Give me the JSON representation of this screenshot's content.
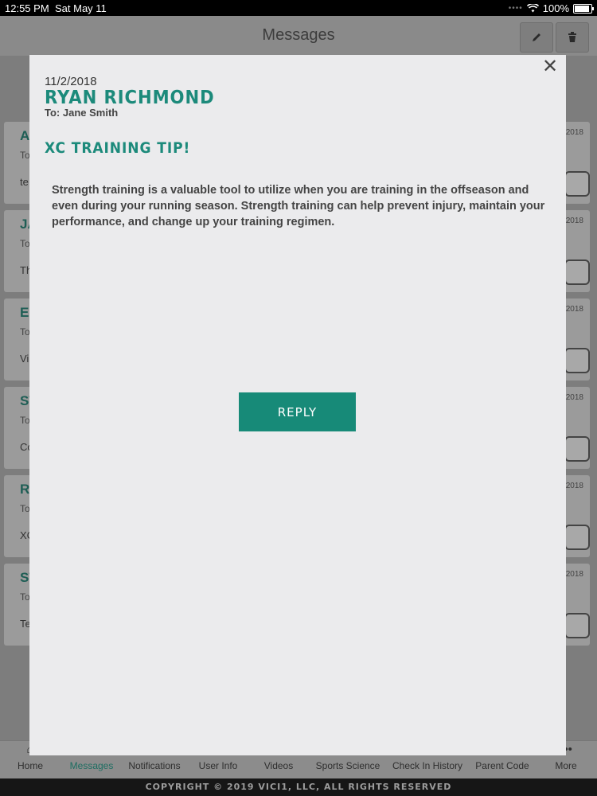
{
  "status_bar": {
    "time": "12:55 PM",
    "date": "Sat May 11",
    "battery": "100%",
    "battery_level": 1.0
  },
  "header": {
    "title": "Messages",
    "compose_icon": "pencil-icon",
    "delete_icon": "trash-icon"
  },
  "background_list": [
    {
      "initial": "A",
      "to": "To",
      "snippet": "te",
      "date": "/2018"
    },
    {
      "initial": "JA",
      "to": "To",
      "snippet": "Th",
      "date": "/2018"
    },
    {
      "initial": "EI",
      "to": "To",
      "snippet": "Vi",
      "date": "/2018"
    },
    {
      "initial": "ST",
      "to": "To",
      "snippet": "Co",
      "date": "/2018"
    },
    {
      "initial": "R",
      "to": "To",
      "snippet": "XC",
      "date": "/2018"
    },
    {
      "initial": "ST",
      "to": "To",
      "snippet": "Te",
      "date": "/2018"
    }
  ],
  "modal": {
    "close_icon": "close-icon",
    "date": "11/2/2018",
    "sender": "RYAN RICHMOND",
    "to": "To: Jane Smith",
    "subject": "XC TRAINING TIP!",
    "body": "Strength training is a valuable tool to utilize when you are training in the offseason and even during your running season. Strength training can help prevent injury, maintain your performance, and change up your training regimen.",
    "reply_label": "REPLY"
  },
  "tabs": [
    {
      "label": "Home",
      "active": false
    },
    {
      "label": "Messages",
      "active": true
    },
    {
      "label": "Notifications",
      "active": false
    },
    {
      "label": "User Info",
      "active": false
    },
    {
      "label": "Videos",
      "active": false
    },
    {
      "label": "Sports Science",
      "active": false
    },
    {
      "label": "Check In History",
      "active": false
    },
    {
      "label": "Parent Code",
      "active": false
    },
    {
      "label": "More",
      "active": false
    }
  ],
  "footer": {
    "copyright": "COPYRIGHT © 2019 VICI1, LLC, ALL RIGHTS RESERVED"
  },
  "colors": {
    "accent": "#178a78",
    "modal_bg": "#ebebed",
    "status_bar": "#000000"
  }
}
